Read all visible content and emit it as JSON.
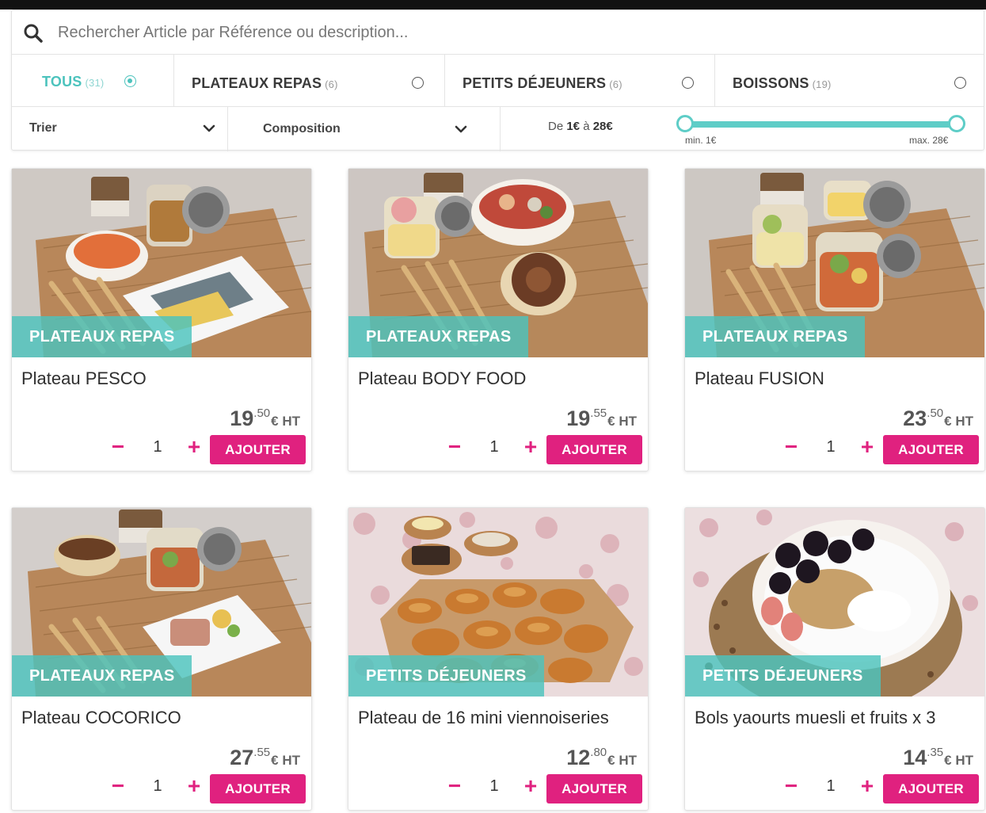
{
  "search": {
    "placeholder": "Rechercher Article par Référence ou description..."
  },
  "categories": [
    {
      "label": "TOUS",
      "count": "(31)",
      "selected": true
    },
    {
      "label": "PLATEAUX REPAS",
      "count": "(6)",
      "selected": false
    },
    {
      "label": "PETITS DÉJEUNERS",
      "count": "(6)",
      "selected": false
    },
    {
      "label": "BOISSONS",
      "count": "(19)",
      "selected": false
    }
  ],
  "sort": {
    "label": "Trier"
  },
  "composition": {
    "label": "Composition"
  },
  "price_range": {
    "prefix": "De ",
    "min_value": "1€",
    "sep": " à ",
    "max_value": "28€",
    "min_label": "min. 1€",
    "max_label": "max. 28€"
  },
  "products": [
    {
      "category": "PLATEAUX REPAS",
      "title": "Plateau PESCO",
      "price_int": "19",
      "price_dec": ".50",
      "price_unit": "€ HT",
      "qty": "1",
      "add_label": "AJOUTER"
    },
    {
      "category": "PLATEAUX REPAS",
      "title": "Plateau BODY FOOD",
      "price_int": "19",
      "price_dec": ".55",
      "price_unit": "€ HT",
      "qty": "1",
      "add_label": "AJOUTER"
    },
    {
      "category": "PLATEAUX REPAS",
      "title": "Plateau FUSION",
      "price_int": "23",
      "price_dec": ".50",
      "price_unit": "€ HT",
      "qty": "1",
      "add_label": "AJOUTER"
    },
    {
      "category": "PLATEAUX REPAS",
      "title": "Plateau COCORICO",
      "price_int": "27",
      "price_dec": ".55",
      "price_unit": "€ HT",
      "qty": "1",
      "add_label": "AJOUTER"
    },
    {
      "category": "PETITS DÉJEUNERS",
      "title": "Plateau de 16 mini viennoiseries",
      "price_int": "12",
      "price_dec": ".80",
      "price_unit": "€ HT",
      "qty": "1",
      "add_label": "AJOUTER"
    },
    {
      "category": "PETITS DÉJEUNERS",
      "title": "Bols yaourts muesli et fruits x 3",
      "price_int": "14",
      "price_dec": ".35",
      "price_unit": "€ HT",
      "qty": "1",
      "add_label": "AJOUTER"
    }
  ],
  "colors": {
    "accent_teal": "#4cc3bd",
    "accent_pink": "#e0217f"
  },
  "icons": {
    "search": "search-icon",
    "dropdown": "chevron-down-icon",
    "minus": "minus-icon",
    "plus": "plus-icon"
  },
  "qty_controls": {
    "minus": "−",
    "plus": "+"
  }
}
